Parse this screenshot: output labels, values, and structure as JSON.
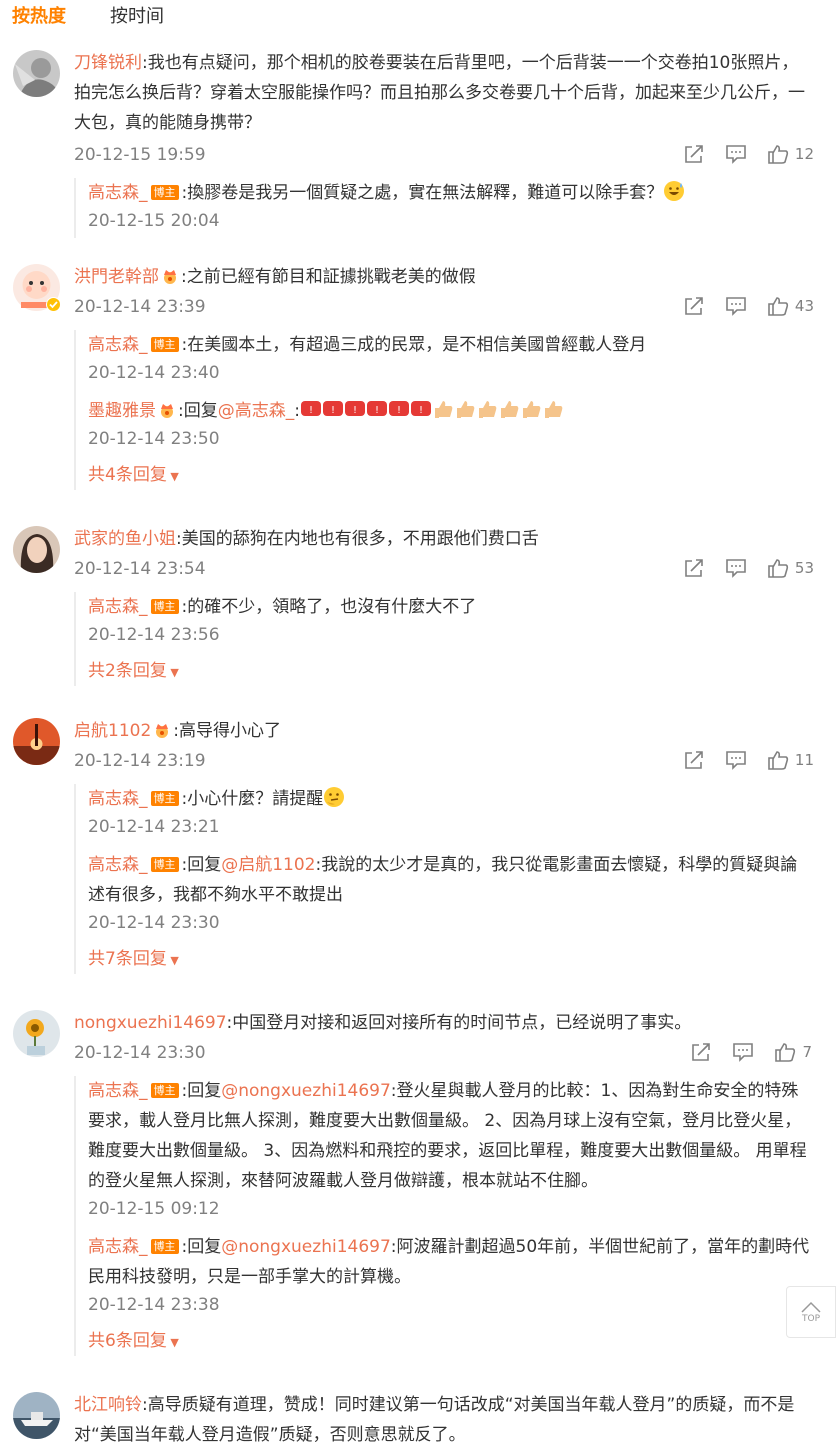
{
  "tabs": [
    {
      "label": "按热度"
    },
    {
      "label": "按时间"
    }
  ],
  "badge_label": "博主",
  "top_label": "TOP",
  "comments": [
    {
      "user": "刀锋锐利",
      "text": ":我也有点疑问，那个相机的胶卷要装在后背里吧，一个后背装一一个交卷拍10张照片，拍完怎么换后背？穿着太空服能操作吗？而且拍那么多交卷要几十个后背，加起来至少几公斤，一大包，真的能随身携带？",
      "time": "20-12-15 19:59",
      "likes": "12",
      "replies": [
        {
          "user": "高志森_",
          "text": ":換膠卷是我另一個質疑之處，實在無法解釋，難道可以除手套？",
          "time": "20-12-15 20:04"
        }
      ]
    },
    {
      "user": "洪門老幹部",
      "text": ":之前已經有節目和証據挑戰老美的做假",
      "time": "20-12-14 23:39",
      "likes": "43",
      "replies": [
        {
          "user": "高志森_",
          "text": ":在美國本土，有超過三成的民眾，是不相信美國曾經載人登月",
          "time": "20-12-14 23:40"
        },
        {
          "user": "墨趣雅景",
          "prefix": ":回复",
          "mention": "@高志森_",
          "text": ":",
          "time": "20-12-14 23:50"
        }
      ],
      "more": "共4条回复"
    },
    {
      "user": "武家的鱼小姐",
      "text": ":美国的舔狗在内地也有很多，不用跟他们费口舌",
      "time": "20-12-14 23:54",
      "likes": "53",
      "replies": [
        {
          "user": "高志森_",
          "text": ":的確不少，領略了，也沒有什麼大不了",
          "time": "20-12-14 23:56"
        }
      ],
      "more": "共2条回复"
    },
    {
      "user": "启航1102",
      "text": ":高导得小心了",
      "time": "20-12-14 23:19",
      "likes": "11",
      "replies": [
        {
          "user": "高志森_",
          "text": ":小心什麼？請提醒",
          "time": "20-12-14 23:21"
        },
        {
          "user": "高志森_",
          "prefix": ":回复",
          "mention": "@启航1102",
          "text": ":我說的太少才是真的，我只從電影畫面去懷疑，科學的質疑與論述有很多，我都不夠水平不敢提出",
          "time": "20-12-14 23:30"
        }
      ],
      "more": "共7条回复"
    },
    {
      "user": "nongxuezhi14697",
      "text": ":中国登月对接和返回对接所有的时间节点，已经说明了事实。",
      "time": "20-12-14 23:30",
      "likes": "7",
      "replies": [
        {
          "user": "高志森_",
          "prefix": ":回复",
          "mention": "@nongxuezhi14697",
          "text": ":登火星與載人登月的比較：1、因為對生命安全的特殊要求，載人登月比無人探測，難度要大出數個量級。 2、因為月球上沒有空氣，登月比登火星，難度要大出數個量級。 3、因為燃料和飛控的要求，返回比單程，難度要大出數個量級。 用單程的登火星無人探測，來替阿波羅載人登月做辯護，根本就站不住腳。",
          "time": "20-12-15 09:12"
        },
        {
          "user": "高志森_",
          "prefix": ":回复",
          "mention": "@nongxuezhi14697",
          "text": ":阿波羅計劃超過50年前，半個世紀前了，當年的劃時代民用科技發明，只是一部手掌大的計算機。",
          "time": "20-12-14 23:38"
        }
      ],
      "more": "共6条回复"
    },
    {
      "user": "北江响铃",
      "text": ":高导质疑有道理，赞成！同时建议第一句话改成“对美国当年载人登月”的质疑，而不是对“美国当年载人登月造假”质疑，否则意思就反了。"
    }
  ]
}
